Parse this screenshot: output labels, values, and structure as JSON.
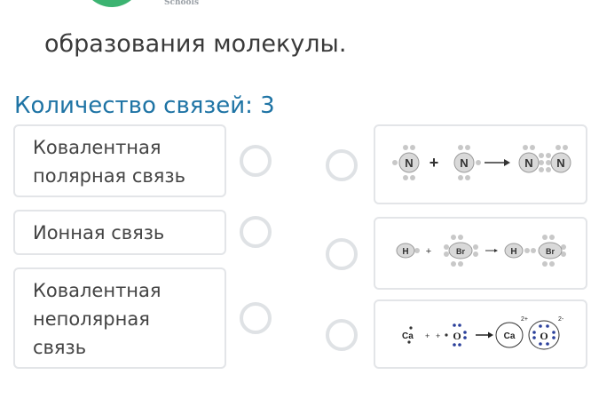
{
  "header": {
    "logo_caption": "Schools"
  },
  "question": {
    "text": "образования молекулы."
  },
  "bond_count": {
    "label": "Количество связей: 3"
  },
  "terms": [
    {
      "label": "Ковалентная полярная связь"
    },
    {
      "label": "Ионная связь"
    },
    {
      "label": "Ковалентная неполярная связь"
    }
  ],
  "diagrams": {
    "n2": {
      "atom": "N"
    },
    "hbr": {
      "h": "H",
      "br": "Br"
    },
    "cao": {
      "ca": "Ca",
      "o": "O",
      "charge": "2-",
      "charge_pos": "2+"
    }
  },
  "colors": {
    "accent": "#1f74a5",
    "logo": "#3cb371",
    "border": "#e3e5e8"
  }
}
